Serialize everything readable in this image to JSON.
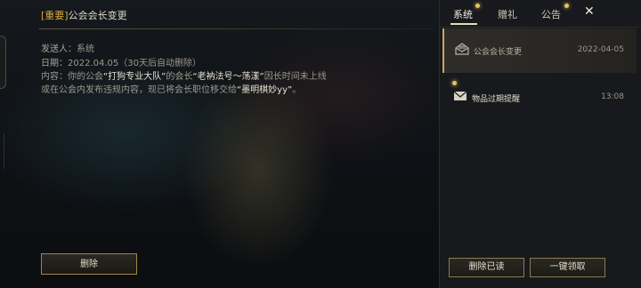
{
  "detail": {
    "title_tag": "[重要]",
    "title": "公会会长变更",
    "sender_label": "发送人：",
    "sender": "系统",
    "date_label": "日期：",
    "date": "2022.04.05（30天后自动删除）",
    "content_label": "内容：",
    "content_parts": [
      "你的公会",
      "“打狗专业大队”",
      "的会长",
      "“老衲法号～荡漾”",
      "因长时间未上线",
      "或在公会内发布违规内容，现已将会长职位移交给",
      "“墨明棋妙yy”",
      "。"
    ],
    "delete_button": "删除"
  },
  "tabs": [
    {
      "label": "系统",
      "active": true,
      "dot": true
    },
    {
      "label": "赠礼",
      "active": false,
      "dot": false
    },
    {
      "label": "公告",
      "active": false,
      "dot": true
    }
  ],
  "mail_list": [
    {
      "name": "公会会长变更",
      "time": "2022-04-05",
      "selected": true,
      "icon": "open-mail-icon"
    },
    {
      "name": "物品过期提醒",
      "time": "13:08",
      "selected": false,
      "icon": "mail-icon",
      "unread": true
    }
  ],
  "buttons": {
    "delete_read": "删除已读",
    "claim_all": "一键领取"
  },
  "colors": {
    "accent_gold": "#c9a35a",
    "tag_gold": "#d7a93a",
    "notify_dot": "#e8c15e"
  }
}
